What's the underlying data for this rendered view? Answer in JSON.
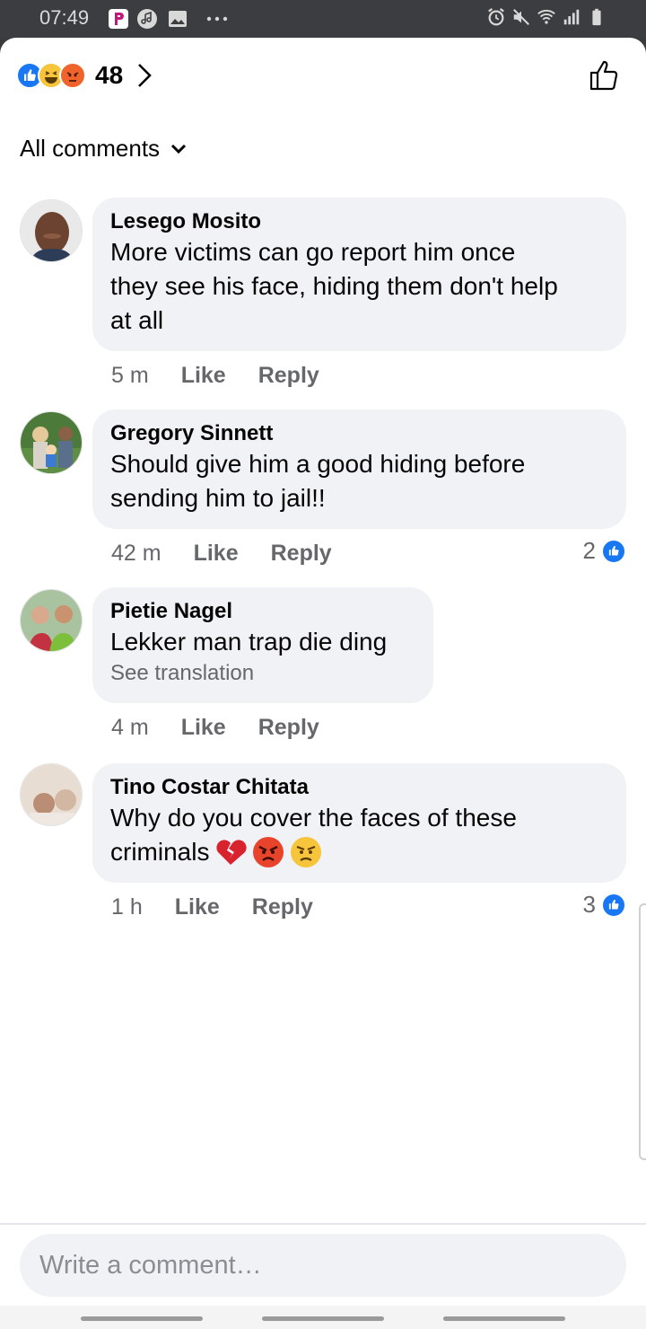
{
  "status": {
    "time": "07:49"
  },
  "reactions": {
    "count": "48"
  },
  "filter": {
    "label": "All comments"
  },
  "comments": [
    {
      "author": "Lesego Mosito",
      "text": [
        "More victims can go report him once",
        "they see his face, hiding them don't help",
        "at all"
      ],
      "time": "5 m",
      "like": "Like",
      "reply": "Reply",
      "likes": ""
    },
    {
      "author": "Gregory Sinnett",
      "text": [
        "Should give him a good hiding before",
        "sending him to jail!!"
      ],
      "time": "42 m",
      "like": "Like",
      "reply": "Reply",
      "likes": "2"
    },
    {
      "author": "Pietie Nagel",
      "text": [
        "Lekker man trap die ding"
      ],
      "translation": "See translation",
      "time": "4 m",
      "like": "Like",
      "reply": "Reply",
      "likes": ""
    },
    {
      "author": "Tino Costar Chitata",
      "text": [
        "Why do you cover the faces of these",
        "criminals"
      ],
      "time": "1 h",
      "like": "Like",
      "reply": "Reply",
      "likes": "3"
    }
  ],
  "composer": {
    "placeholder": "Write a comment…"
  },
  "colors": {
    "accent": "#1877f2",
    "bubble": "#f0f2f5",
    "meta": "#65676b"
  }
}
